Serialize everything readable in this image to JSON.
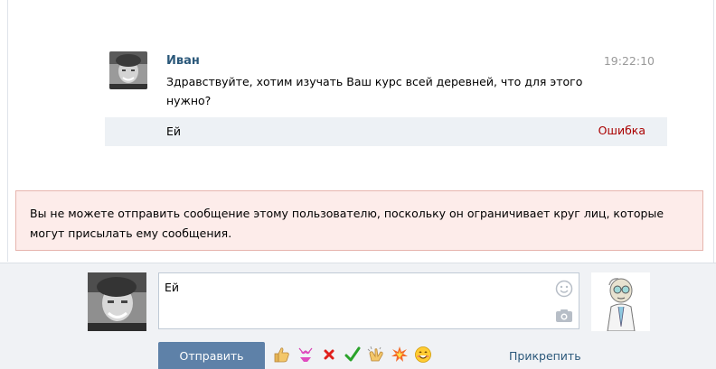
{
  "message": {
    "author": "Иван",
    "time": "19:22:10",
    "text": "Здравствуйте, хотим изучать Ваш курс всей деревней, что для этого нужно?"
  },
  "failed_message": {
    "text": "Ей",
    "status": "Ошибка"
  },
  "error": {
    "text": "Вы не можете отправить сообщение этому пользователю, поскольку он ограничивает круг лиц, которые могут присылать ему сообщения."
  },
  "composer": {
    "value": "Ей",
    "send_label": "Отправить",
    "attach_label": "Прикрепить",
    "emoji": [
      "thumbs-up-icon",
      "bikini-icon",
      "cross-mark-icon",
      "check-mark-icon",
      "clapping-hands-icon",
      "collision-icon",
      "smiling-face-icon"
    ]
  },
  "colors": {
    "link": "#2b587a",
    "error_status": "#aa0000",
    "error_bg": "#fdecea",
    "button": "#5e81a8"
  }
}
